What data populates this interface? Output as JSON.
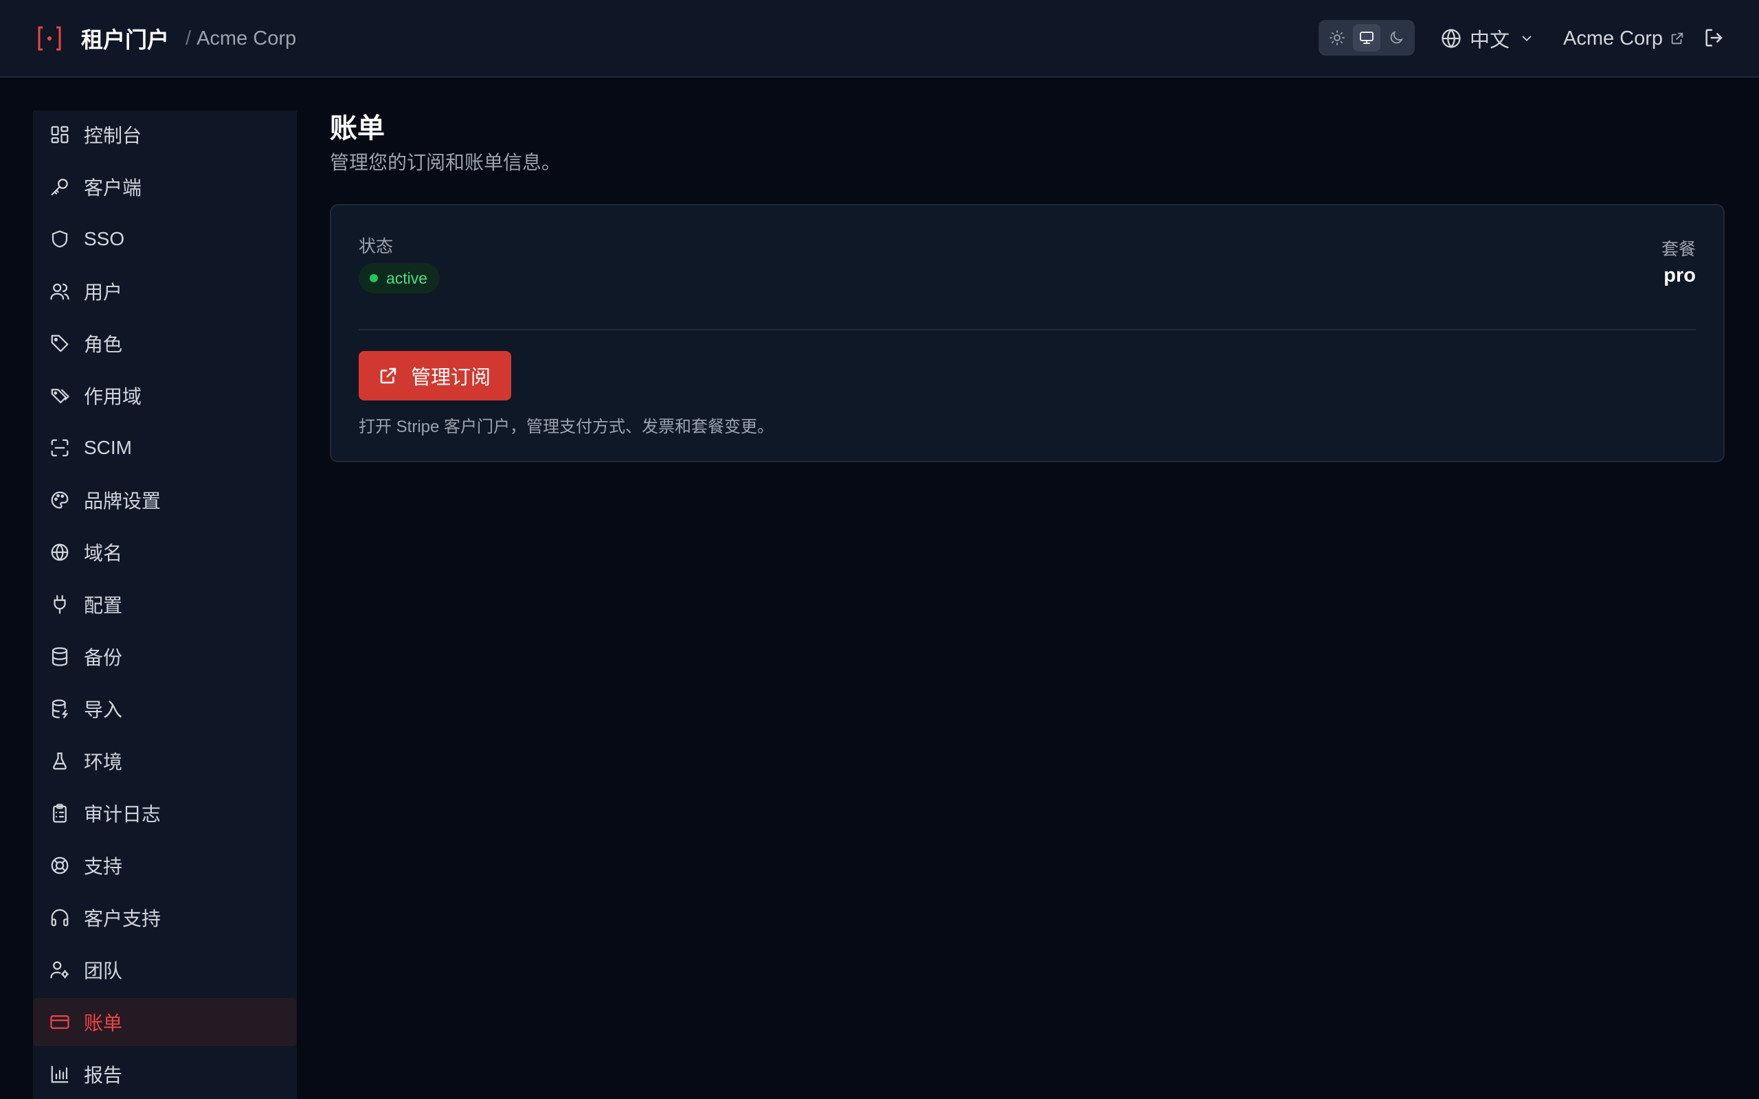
{
  "header": {
    "title": "租户门户",
    "separator": "/",
    "org": "Acme Corp",
    "theme_options": [
      "light",
      "system",
      "dark"
    ],
    "theme_active": "system",
    "language": "中文",
    "org_link": "Acme Corp"
  },
  "sidebar": {
    "items": [
      {
        "label": "控制台",
        "icon": "layout-dashboard-icon"
      },
      {
        "label": "客户端",
        "icon": "key-icon"
      },
      {
        "label": "SSO",
        "icon": "shield-icon"
      },
      {
        "label": "用户",
        "icon": "users-icon"
      },
      {
        "label": "角色",
        "icon": "tag-icon"
      },
      {
        "label": "作用域",
        "icon": "tags-icon"
      },
      {
        "label": "SCIM",
        "icon": "scan-icon"
      },
      {
        "label": "品牌设置",
        "icon": "palette-icon"
      },
      {
        "label": "域名",
        "icon": "globe-icon"
      },
      {
        "label": "配置",
        "icon": "plug-icon"
      },
      {
        "label": "备份",
        "icon": "database-icon"
      },
      {
        "label": "导入",
        "icon": "database-import-icon"
      },
      {
        "label": "环境",
        "icon": "flask-icon"
      },
      {
        "label": "审计日志",
        "icon": "clipboard-list-icon"
      },
      {
        "label": "支持",
        "icon": "life-buoy-icon"
      },
      {
        "label": "客户支持",
        "icon": "headphones-icon"
      },
      {
        "label": "团队",
        "icon": "user-cog-icon"
      },
      {
        "label": "账单",
        "icon": "credit-card-icon"
      },
      {
        "label": "报告",
        "icon": "bar-chart-icon"
      }
    ],
    "active_index": 17
  },
  "main": {
    "title": "账单",
    "subtitle": "管理您的订阅和账单信息。",
    "card": {
      "status_label": "状态",
      "status_value": "active",
      "plan_label": "套餐",
      "plan_value": "pro",
      "manage_button": "管理订阅",
      "note": "打开 Stripe 客户门户，管理支付方式、发票和套餐变更。"
    }
  },
  "colors": {
    "accent": "#d1382f",
    "active_nav_text": "#ef4444",
    "status_green": "#22c55e",
    "background": "#050a14",
    "surface": "#0f1625"
  }
}
